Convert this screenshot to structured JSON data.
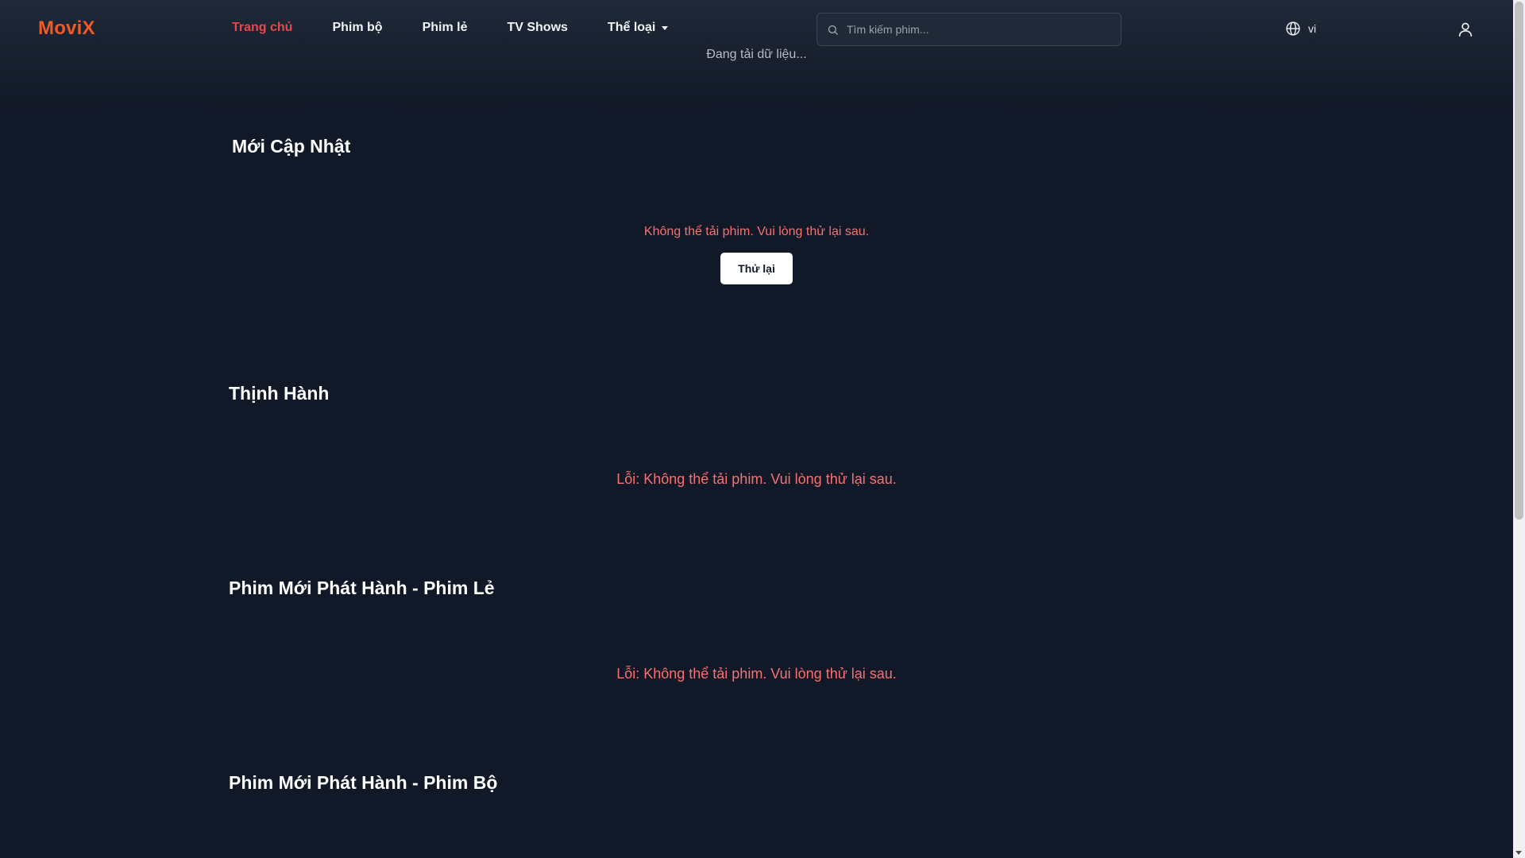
{
  "header": {
    "logo": "MoviX",
    "nav": [
      {
        "label": "Trang chủ",
        "active": true
      },
      {
        "label": "Phim bộ"
      },
      {
        "label": "Phim lẻ"
      },
      {
        "label": "TV Shows"
      },
      {
        "label": "Thể loại",
        "dropdown": true
      }
    ],
    "search": {
      "placeholder": "Tìm kiếm phim...",
      "value": ""
    },
    "language": "vi",
    "loading_text": "Đang tải dữ liệu..."
  },
  "sections": [
    {
      "title": "Mới Cập Nhật",
      "error": "Không thể tải phim. Vui lòng thử lại sau.",
      "retry_label": "Thử lại"
    },
    {
      "title": "Thịnh Hành",
      "error": "Lỗi: Không thể tải phim. Vui lòng thử lại sau."
    },
    {
      "title": "Phim Mới Phát Hành - Phim Lẻ",
      "error": "Lỗi: Không thể tải phim. Vui lòng thử lại sau."
    },
    {
      "title": "Phim Mới Phát Hành - Phim Bộ"
    }
  ],
  "colors": {
    "background": "#111827",
    "brand": "#f05a28",
    "nav_active": "#e5484d",
    "error": "#f87171"
  },
  "icons": {
    "search": "search-icon",
    "language": "globe-icon",
    "user": "user-icon",
    "dropdown": "chevron-down-icon"
  }
}
